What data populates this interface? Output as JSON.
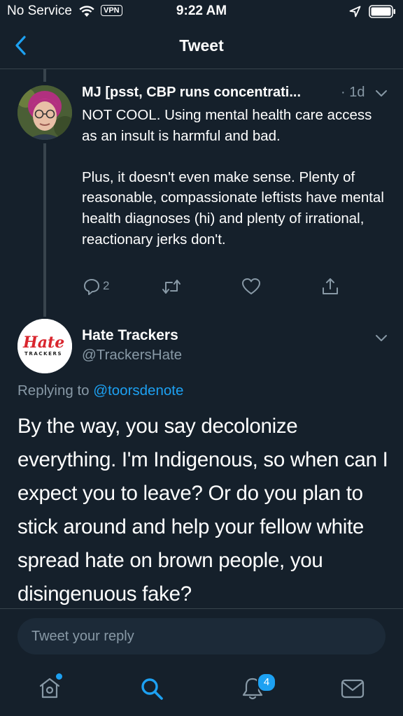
{
  "status_bar": {
    "carrier": "No Service",
    "vpn": "VPN",
    "time": "9:22 AM"
  },
  "nav": {
    "title": "Tweet"
  },
  "parent_tweet": {
    "display_name": "MJ [psst, CBP runs concentrati...",
    "age": "· 1d",
    "text": "NOT COOL. Using mental health care access as an insult is harmful and bad.\n\nPlus, it doesn't even make sense. Plenty of reasonable, compassionate leftists have mental health diagnoses (hi) and plenty of irrational, reactionary jerks don't.",
    "reply_count": "2"
  },
  "main_tweet": {
    "avatar_logo": "Hate TRACKERS",
    "display_name": "Hate Trackers",
    "handle": "@TrackersHate",
    "replying_prefix": "Replying to ",
    "replying_to": "@toorsdenote",
    "text": "By the way, you say decolonize everything. I'm Indigenous, so when can I expect you to leave? Or do you plan to stick around and help your fellow white spread hate on brown people, you disingenuous fake?"
  },
  "reply_box": {
    "placeholder": "Tweet your reply"
  },
  "tab_bar": {
    "notification_count": "4"
  },
  "colors": {
    "background": "#15202b",
    "accent": "#1da1f2",
    "secondary_text": "#8899a6",
    "divider": "#38444d"
  }
}
